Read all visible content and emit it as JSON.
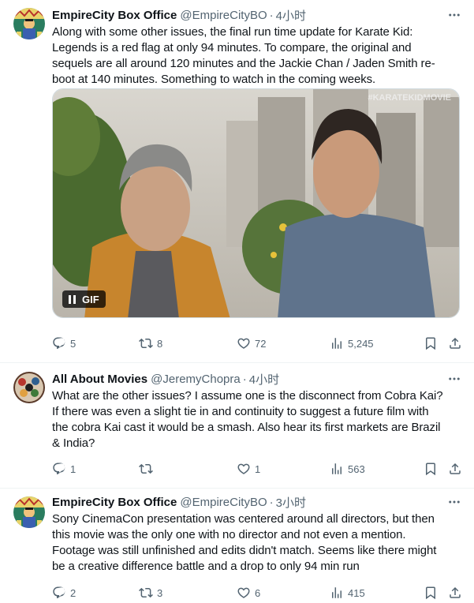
{
  "colors": {
    "text": "#0f1419",
    "secondary": "#536471",
    "divider": "#eff3f4"
  },
  "tweets": [
    {
      "avatar_icon": "empire-city-logo-avatar",
      "name": "EmpireCity Box Office",
      "handle": "@EmpireCityBO",
      "separator": "·",
      "time": "4小时",
      "text_lines": [
        "Along with some other issues, the final run time update for Karate Kid:",
        "Legends is a red flag at only 94 minutes.  To compare, the original and",
        "sequels are all around 120 minutes and the Jackie Chan / Jaden Smith re-",
        "boot at 140 minutes.  Something to watch in the coming weeks."
      ],
      "media": {
        "type": "gif",
        "badge_label": "GIF",
        "watermark": "#KARATEKIDMOVIE"
      },
      "stats": {
        "replies": "5",
        "retweets": "8",
        "likes": "72",
        "views": "5,245"
      }
    },
    {
      "avatar_icon": "all-about-movies-avatar",
      "name": "All About Movies",
      "handle": "@JeremyChopra",
      "separator": "·",
      "time": "4小时",
      "text_lines": [
        "What are the other issues? I assume one is the disconnect from Cobra Kai?",
        "If there was even a slight tie in and continuity to suggest a future film with",
        "the cobra Kai cast it would be a smash. Also hear its first markets are Brazil",
        "& India?"
      ],
      "stats": {
        "replies": "1",
        "retweets": "",
        "likes": "1",
        "views": "563"
      }
    },
    {
      "avatar_icon": "empire-city-logo-avatar",
      "name": "EmpireCity Box Office",
      "handle": "@EmpireCityBO",
      "separator": "·",
      "time": "3小时",
      "text_lines": [
        "Sony CinemaCon presentation was centered around all directors, but then",
        "this movie was the only one with no director and not even a mention.",
        "Footage was still unfinished and edits didn't match.  Seems like there might",
        "be a creative difference battle and a drop to only 94 min run"
      ],
      "stats": {
        "replies": "2",
        "retweets": "3",
        "likes": "6",
        "views": "415"
      }
    }
  ]
}
